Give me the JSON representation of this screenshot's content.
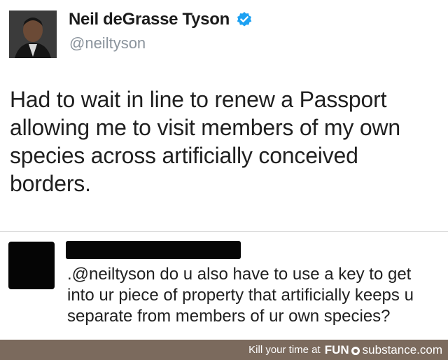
{
  "tweet": {
    "author_name": "Neil deGrasse Tyson",
    "author_handle": "@neiltyson",
    "verified_icon": "verified-badge-icon",
    "body_lines": [
      "Had to wait in line to renew a Passport",
      "allowing me to visit members of my own",
      "species across artificially conceived",
      "borders."
    ]
  },
  "reply": {
    "body_lines": [
      ".@neiltyson do u also have to use a key to get",
      "into ur piece of property that artificially keeps u",
      "separate from members of ur own species?"
    ]
  },
  "watermark": {
    "text": "Kill your time at",
    "brand_part1": "FUN",
    "brand_part2": "substance",
    "brand_part3": ".com"
  },
  "colors": {
    "verified_blue": "#1da1f2",
    "handle_gray": "#8a939c",
    "watermark_bg": "#7b6a5d"
  }
}
